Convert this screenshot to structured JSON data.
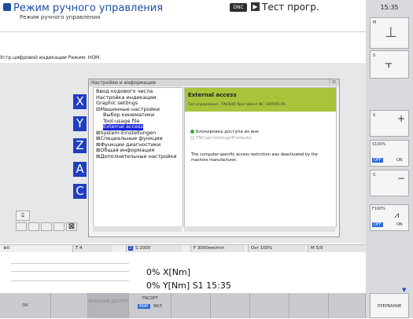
{
  "header": {
    "title": "Режим ручного управления",
    "subtitle": "Режим ручного управления",
    "dnc_badge": "DNC",
    "test_title": "Тест прогр.",
    "clock": "15:35"
  },
  "mode_line": "Устр.цифровой индикации Режим: НОМ.",
  "dialog": {
    "title": "Настройки и информация",
    "tree": [
      {
        "label": "Ввод кодового числа",
        "indent": 0,
        "selected": false
      },
      {
        "label": "Настройка индикации",
        "indent": 0,
        "selected": false
      },
      {
        "label": "Graphic settings",
        "indent": 0,
        "selected": false
      },
      {
        "label": "⊟Машинные настройки",
        "indent": 0,
        "selected": false
      },
      {
        "label": "Выбор кинематики",
        "indent": 1,
        "selected": false
      },
      {
        "label": "Tool-usage file",
        "indent": 1,
        "selected": false
      },
      {
        "label": "External access",
        "indent": 1,
        "selected": true
      },
      {
        "label": "⊞System-Einstellungen",
        "indent": 0,
        "selected": false
      },
      {
        "label": "⊞Специальные функции",
        "indent": 0,
        "selected": false
      },
      {
        "label": "⊞Функции диагностики",
        "indent": 0,
        "selected": false
      },
      {
        "label": "⊞Общая информация",
        "indent": 0,
        "selected": false
      },
      {
        "label": "⊞Дополнительные настройки",
        "indent": 0,
        "selected": false
      }
    ],
    "pane": {
      "heading": "External access",
      "subheading": "Тип управления : TNC640  Прог.обесп NC: 340595 09",
      "option_block": "Блокировка доступа из вне",
      "option_tncopt": "TNCopt-Vollzugriff erlaubt",
      "message": "The computer-specific access restriction was deactivated by the machine manufacturer."
    }
  },
  "side_tiles": [
    "X",
    "Y",
    "Z",
    "A",
    "C"
  ],
  "status_bar": {
    "t_label": "T 4",
    "s_label": "S 2000",
    "f_label": "F 3000мм/min",
    "ovr": "Ovr 100%",
    "m": "M 5/9"
  },
  "readout": {
    "line1": "0% X[Nm]",
    "line2": "0% Y[Nm]  S1  15:35"
  },
  "softkeys": [
    {
      "label": "OK"
    },
    {
      "label": ""
    },
    {
      "label": "ВНЕШНИЙ ДОСТУП"
    },
    {
      "label": "TNCOPT"
    },
    {
      "label": ""
    },
    {
      "label": ""
    },
    {
      "label": ""
    },
    {
      "label": ""
    },
    {
      "label": ""
    }
  ],
  "softkey_toggle": {
    "off": "ВЫК",
    "on": "ВКЛ"
  },
  "right_panel": {
    "m_label": "M",
    "s_label": "S",
    "s100": "S100%",
    "off1": "OFF",
    "on1": "ON",
    "f100": "F100%",
    "off2": "OFF",
    "on2": "ON",
    "interrupt": "ПРЕРВАНИЕ"
  }
}
